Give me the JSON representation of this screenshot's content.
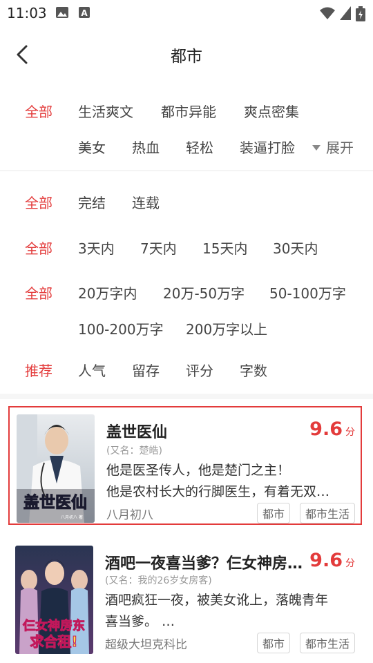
{
  "status": {
    "time": "11:03"
  },
  "header": {
    "title": "都市"
  },
  "filters": {
    "category": {
      "active": "全部",
      "options": [
        "生活爽文",
        "都市异能",
        "爽点密集",
        "美女",
        "热血",
        "轻松",
        "装逼打脸"
      ],
      "expand_label": "展开"
    },
    "status": {
      "active": "全部",
      "options": [
        "完结",
        "连载"
      ]
    },
    "update": {
      "active": "全部",
      "options": [
        "3天内",
        "7天内",
        "15天内",
        "30天内"
      ]
    },
    "words": {
      "active": "全部",
      "options": [
        "20万字内",
        "20万-50万字",
        "50-100万字",
        "100-200万字",
        "200万字以上"
      ]
    },
    "sort": {
      "active": "推荐",
      "options": [
        "人气",
        "留存",
        "评分",
        "字数"
      ]
    }
  },
  "books": [
    {
      "title": "盖世医仙",
      "alias": "(又名：楚皓)",
      "desc_line1": "他是医圣传人，他是楚门之主！",
      "desc_line2": "他是农村长大的行脚医生，有着无双…",
      "author": "八月初八",
      "score": "9.6",
      "score_unit": "分",
      "tags": [
        "都市",
        "都市生活"
      ],
      "cover_text": "盖世医仙",
      "cover_author": "八月初八 著"
    },
    {
      "title": "酒吧一夜喜当爹？仨女神房…",
      "alias": "(又名：我的26岁女房客)",
      "desc_line1": "酒吧疯狂一夜，被美女讹上，落魄青年",
      "desc_line2": "喜当爹。 …",
      "author": "超级大坦克科比",
      "score": "9.6",
      "score_unit": "分",
      "tags": [
        "都市",
        "都市生活"
      ],
      "cover_text_1": "仨女神房东",
      "cover_text_2": "求合租!"
    }
  ]
}
